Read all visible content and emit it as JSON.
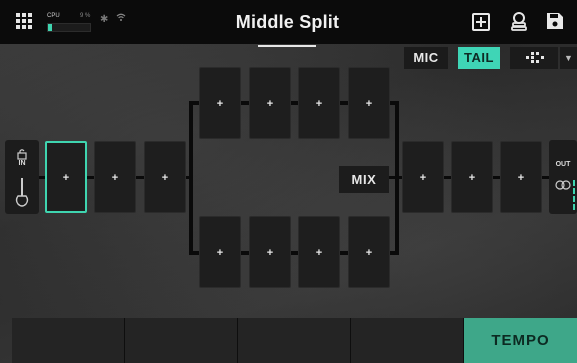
{
  "header": {
    "title": "Middle Split",
    "cpu_label": "CPU",
    "cpu_percent_text": "9 %",
    "cpu_load": 0.09
  },
  "icons": {
    "menu": "grid-icon",
    "bluetooth": "bluetooth-icon",
    "wifi": "wifi-icon",
    "add": "add-block-icon",
    "tuner": "tuner-icon",
    "save": "save-icon"
  },
  "controls": {
    "mic_label": "MIC",
    "tail_label": "TAIL",
    "tail_active": true
  },
  "chain": {
    "in_label": "IN",
    "out_label": "OUT",
    "mix_label": "MIX",
    "slot_symbol": "+",
    "pre_split_slots": [
      "+",
      "+",
      "+"
    ],
    "path_a_slots": [
      "+",
      "+",
      "+",
      "+"
    ],
    "path_b_slots": [
      "+",
      "+",
      "+",
      "+"
    ],
    "post_mix_slots": [
      "+",
      "+",
      "+"
    ],
    "selected_slot": "pre-1"
  },
  "footer": {
    "tempo_label": "TEMPO"
  },
  "colors": {
    "accent": "#3fd5b6",
    "tempo": "#3ea789",
    "topbar": "#0b0b0b"
  }
}
